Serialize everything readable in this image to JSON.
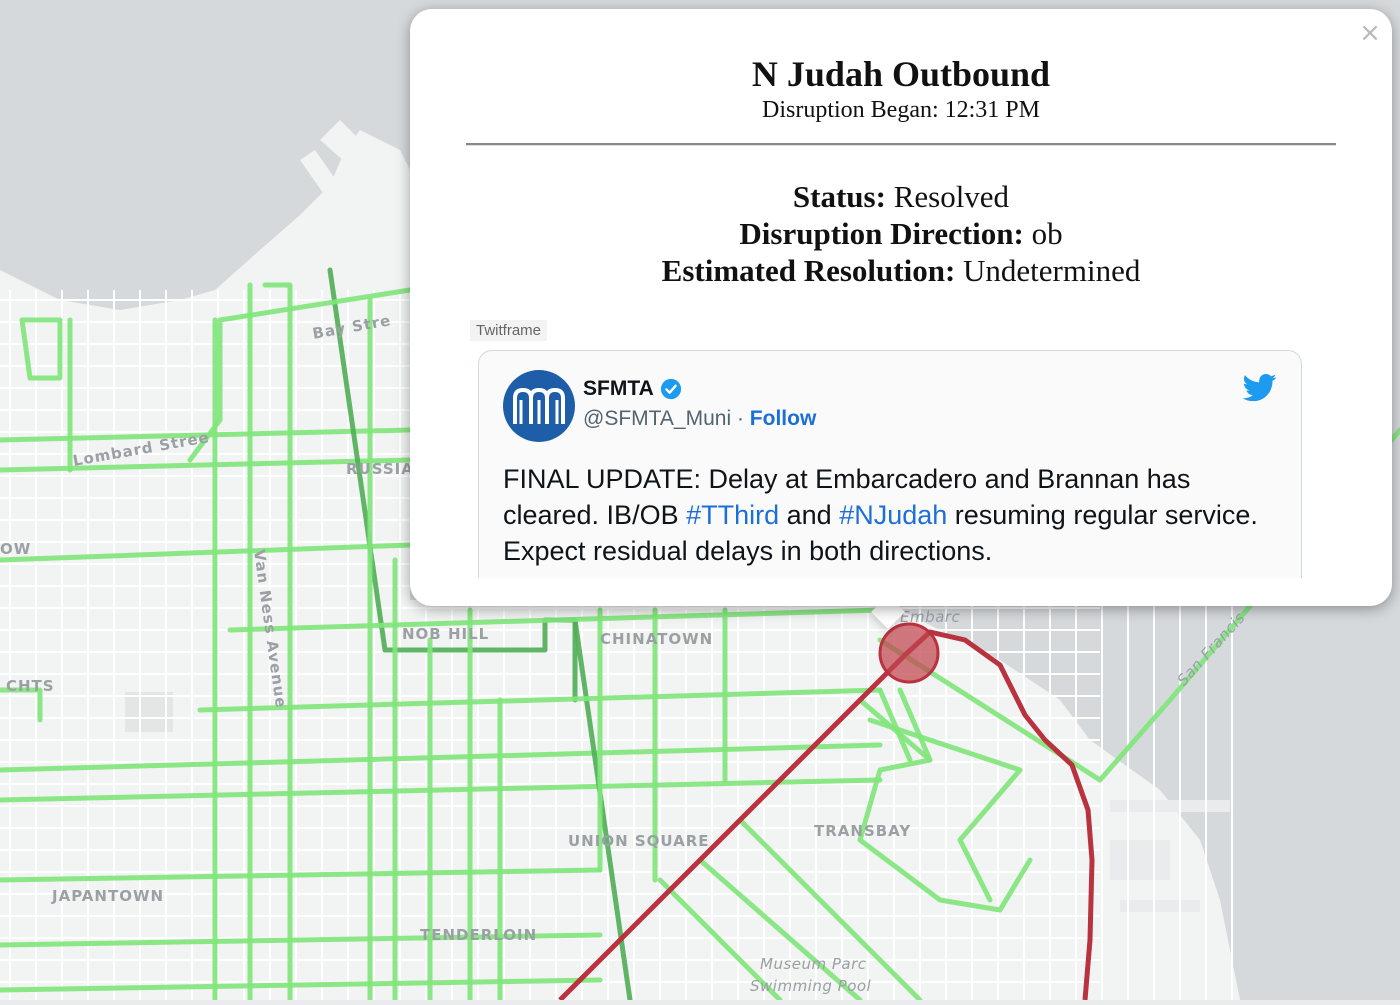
{
  "map": {
    "labels": [
      {
        "id": "bay-street",
        "text": "Bay Stre"
      },
      {
        "id": "lombard-street",
        "text": "Lombard Stree"
      },
      {
        "id": "russian-hill",
        "text": "RUSSIA"
      },
      {
        "id": "cow-hollow",
        "text": "OW"
      },
      {
        "id": "van-ness-avenue",
        "text": "Van Ness Avenue"
      },
      {
        "id": "nob-hill",
        "text": "NOB HILL"
      },
      {
        "id": "chinatown",
        "text": "CHINATOWN"
      },
      {
        "id": "heights",
        "text": "CHTS"
      },
      {
        "id": "union-square",
        "text": "UNION SQUARE"
      },
      {
        "id": "transbay",
        "text": "TRANSBAY"
      },
      {
        "id": "japantown",
        "text": "JAPANTOWN"
      },
      {
        "id": "tenderloin",
        "text": "TENDERLOIN"
      },
      {
        "id": "museum-park",
        "text": "Museum Parc"
      },
      {
        "id": "swimming-pool",
        "text": "Swimming Pool"
      },
      {
        "id": "san-francisco-bay-bridge",
        "text": "San Francis"
      },
      {
        "id": "embarcadero",
        "text": "Embarc"
      }
    ],
    "colors": {
      "water": "#d6d9dc",
      "land": "#f2f3f3",
      "route_normal": "#7fe57a",
      "route_dark": "#4fae55",
      "route_disrupted": "#b8323f",
      "disruption_marker": "#c0444e"
    }
  },
  "popup": {
    "close_label": "×",
    "title": "N Judah Outbound",
    "subtitle_label": "Disruption Began:",
    "subtitle_value": "12:31 PM",
    "status_label": "Status:",
    "status_value": "Resolved",
    "direction_label": "Disruption Direction:",
    "direction_value": "ob",
    "resolution_label": "Estimated Resolution:",
    "resolution_value": "Undetermined",
    "twitframe_label": "Twitframe"
  },
  "tweet": {
    "account_name": "SFMTA",
    "handle": "@SFMTA_Muni",
    "separator": " · ",
    "follow_label": "Follow",
    "text_part1": "FINAL UPDATE: Delay at Embarcadero and Brannan has cleared. IB/OB ",
    "hashtag1": "#TThird",
    "text_part2": " and ",
    "hashtag2": "#NJudah",
    "text_part3": " resuming regular service. Expect residual delays in both directions.",
    "icons": {
      "avatar": "sfmta-logo-icon",
      "verified": "verified-badge-icon",
      "platform": "twitter-bird-icon"
    }
  }
}
